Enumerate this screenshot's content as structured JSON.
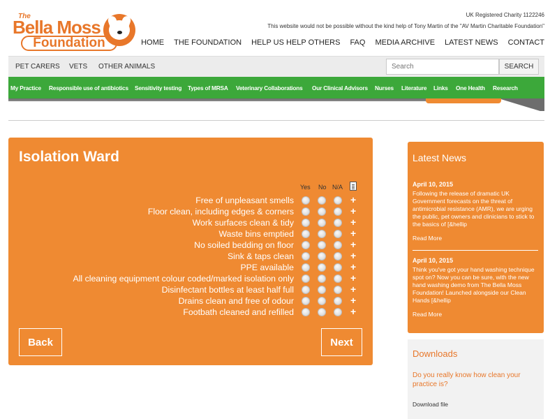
{
  "brand": {
    "the": "The",
    "name": "Bella Moss",
    "foundation": "Foundation"
  },
  "header": {
    "charity": "UK Registered Charity 1122246",
    "thanks": "This website would not be possible without the kind help of Tony Martin of the \"AV Martin Charitable Foundation\"",
    "nav": [
      "HOME",
      "THE FOUNDATION",
      "HELP US HELP OTHERS",
      "FAQ",
      "MEDIA ARCHIVE",
      "LATEST NEWS",
      "CONTACT"
    ]
  },
  "subnav": {
    "items": [
      "PET CARERS",
      "VETS",
      "OTHER ANIMALS"
    ],
    "search_placeholder": "Search",
    "search_button": "SEARCH"
  },
  "greenbar": [
    "My Practice",
    "Responsible use of antibiotics",
    "Sensitivity testing",
    "Types of MRSA",
    "Veterinary Collaborations",
    "Our Clinical Advisors",
    "Nurses",
    "Literature",
    "Links",
    "One Health",
    "Research"
  ],
  "checklist": {
    "title": "Isolation Ward",
    "columns": [
      "Yes",
      "No",
      "N/A"
    ],
    "items": [
      "Free of unpleasant smells",
      "Floor clean, including edges & corners",
      "Work surfaces clean & tidy",
      "Waste bins emptied",
      "No soiled bedding on floor",
      "Sink & taps clean",
      "PPE available",
      "All cleaning equipment colour coded/marked isolation only",
      "Disinfectant bottles at least half full",
      "Drains clean and free of odour",
      "Footbath cleaned and refilled"
    ],
    "plus": "+",
    "back": "Back",
    "next": "Next"
  },
  "news": {
    "title": "Latest News",
    "items": [
      {
        "date": "April 10, 2015",
        "text": "Following the release of dramatic UK Government forecasts on the threat of antimicrobial resistance (AMR), we are urging the public, pet owners and clinicians to stick to the basics of [&hellip",
        "more": "Read More"
      },
      {
        "date": "April 10, 2015",
        "text": "Think you've got your hand washing technique spot on? Now you can be sure, with the new hand washing demo from The Bella Moss Foundation! Launched alongside our Clean Hands [&hellip",
        "more": "Read More"
      }
    ]
  },
  "downloads": {
    "title": "Downloads",
    "question": "Do you really know how clean your practice is?",
    "link": "Download file"
  },
  "colors": {
    "orange": "#ef8a32",
    "green": "#3ca83a",
    "grey": "#ececec"
  }
}
